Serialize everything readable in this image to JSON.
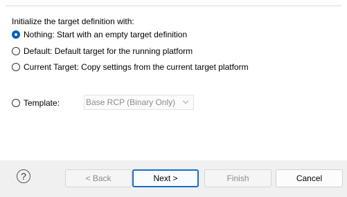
{
  "wizard": {
    "intro": "Initialize the target definition with:",
    "options": [
      {
        "label": "Nothing: Start with an empty target definition",
        "selected": true
      },
      {
        "label": "Default: Default target for the running platform",
        "selected": false
      },
      {
        "label": "Current Target: Copy settings from the current target platform",
        "selected": false
      },
      {
        "label": "Template:",
        "selected": false
      }
    ],
    "template_select": {
      "value": "Base RCP (Binary Only)",
      "enabled": false
    }
  },
  "footer": {
    "help_icon": "?",
    "buttons": {
      "back": "< Back",
      "next": "Next >",
      "finish": "Finish",
      "cancel": "Cancel"
    }
  },
  "colors": {
    "selected_radio": "#005fb8",
    "default_button_border": "#1a6dc2",
    "disabled_text": "#8b8b8b"
  }
}
